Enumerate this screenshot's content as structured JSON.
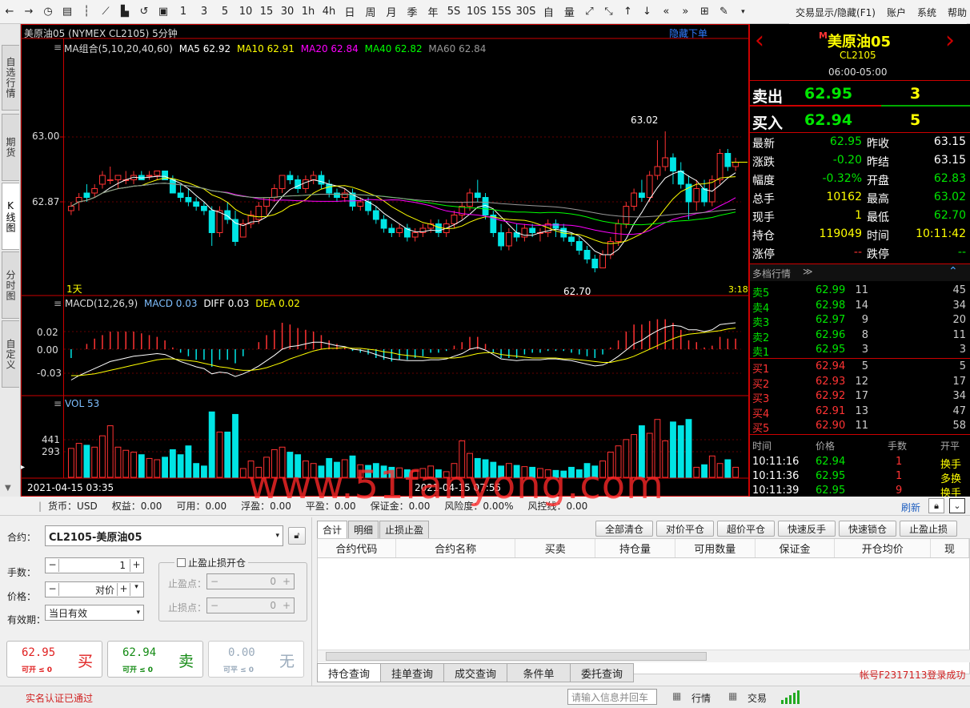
{
  "toolbar": {
    "items": [
      "1",
      "3",
      "5",
      "10",
      "15",
      "30",
      "1h",
      "4h",
      "日",
      "周",
      "月",
      "季",
      "年",
      "5S",
      "10S",
      "15S",
      "30S",
      "自",
      "量"
    ],
    "menu": [
      "交易显示/隐藏(F1)",
      "账户",
      "系统",
      "帮助"
    ]
  },
  "left_tabs": [
    "自选行情",
    "期货",
    "K线图",
    "分时图",
    "自定义"
  ],
  "chart": {
    "title": "美原油05 (NYMEX CL2105) 5分钟",
    "hide_order": "隐藏下单",
    "ma": {
      "label": "MA组合(5,10,20,40,60)",
      "ma5": "MA5 62.92",
      "ma10": "MA10 62.91",
      "ma20": "MA20 62.84",
      "ma40": "MA40 62.82",
      "ma60": "MA60 62.84"
    },
    "price_ticks": [
      "63.00",
      "62.87"
    ],
    "high_label": "63.02",
    "low_label": "62.70",
    "period_label": "1天",
    "countdown": "3:18",
    "macd": {
      "label": "MACD(12,26,9)",
      "macd": "MACD 0.03",
      "diff": "DIFF 0.03",
      "dea": "DEA 0.02",
      "ticks": [
        "0.02",
        "0.00",
        "-0.03"
      ]
    },
    "vol": {
      "label": "VOL 53",
      "ticks": [
        "441",
        "293"
      ]
    },
    "time_left": "2021-04-15 03:35",
    "time_mid": "2021-04-15 07:55"
  },
  "colors": {
    "up": "#ff3232",
    "down": "#00e5e5",
    "ma5": "#ffffff",
    "ma10": "#ffff00",
    "ma20": "#ff00ff",
    "ma40": "#00ff00",
    "ma60": "#999999"
  },
  "quote": {
    "name_prefix": "M",
    "name": "美原油05",
    "code": "CL2105",
    "session": "06:00-05:00",
    "sell_label": "卖出",
    "sell_price": "62.95",
    "sell_qty": "3",
    "buy_label": "买入",
    "buy_price": "62.94",
    "buy_qty": "5",
    "stats": [
      {
        "l1": "最新",
        "v1": "62.95",
        "c1": "g",
        "l2": "昨收",
        "v2": "63.15",
        "c2": "w"
      },
      {
        "l1": "涨跌",
        "v1": "-0.20",
        "c1": "g",
        "l2": "昨结",
        "v2": "63.15",
        "c2": "w"
      },
      {
        "l1": "幅度",
        "v1": "-0.32%",
        "c1": "g",
        "l2": "开盘",
        "v2": "62.83",
        "c2": "g"
      },
      {
        "l1": "总手",
        "v1": "10162",
        "c1": "y",
        "l2": "最高",
        "v2": "63.02",
        "c2": "g"
      },
      {
        "l1": "现手",
        "v1": "1",
        "c1": "y",
        "l2": "最低",
        "v2": "62.70",
        "c2": "g"
      },
      {
        "l1": "持仓",
        "v1": "119049",
        "c1": "y",
        "l2": "时间",
        "v2": "10:11:42",
        "c2": "y"
      },
      {
        "l1": "涨停",
        "v1": "--",
        "c1": "r",
        "l2": "跌停",
        "v2": "--",
        "c2": "g"
      }
    ],
    "depth_title": "多档行情",
    "asks": [
      {
        "l": "卖5",
        "p": "62.99",
        "q": "11",
        "t": "45"
      },
      {
        "l": "卖4",
        "p": "62.98",
        "q": "14",
        "t": "34"
      },
      {
        "l": "卖3",
        "p": "62.97",
        "q": "9",
        "t": "20"
      },
      {
        "l": "卖2",
        "p": "62.96",
        "q": "8",
        "t": "11"
      },
      {
        "l": "卖1",
        "p": "62.95",
        "q": "3",
        "t": "3"
      }
    ],
    "bids": [
      {
        "l": "买1",
        "p": "62.94",
        "q": "5",
        "t": "5"
      },
      {
        "l": "买2",
        "p": "62.93",
        "q": "12",
        "t": "17"
      },
      {
        "l": "买3",
        "p": "62.92",
        "q": "17",
        "t": "34"
      },
      {
        "l": "买4",
        "p": "62.91",
        "q": "13",
        "t": "47"
      },
      {
        "l": "买5",
        "p": "62.90",
        "q": "11",
        "t": "58"
      }
    ],
    "tick_headers": [
      "时间",
      "价格",
      "手数",
      "开平"
    ],
    "ticks": [
      {
        "t": "10:11:16",
        "p": "62.94",
        "q": "1",
        "k": "换手"
      },
      {
        "t": "10:11:36",
        "p": "62.95",
        "q": "1",
        "k": "多换"
      },
      {
        "t": "10:11:39",
        "p": "62.95",
        "q": "9",
        "k": "换手"
      }
    ]
  },
  "account_bar": {
    "items": [
      "货币：USD",
      "权益：0.00",
      "可用：0.00",
      "浮盈：0.00",
      "平盈：0.00",
      "保证金：0.00",
      "风险度：0.00%",
      "风控线：0.00"
    ],
    "refresh": "刷新"
  },
  "order": {
    "contract_label": "合约：",
    "contract_value": "CL2105-美原油05",
    "qty_label": "手数：",
    "qty_value": "1",
    "price_label": "价格：",
    "price_value": "对价",
    "valid_label": "有效期：",
    "valid_value": "当日有效",
    "stop_check": "止盈止损开仓",
    "tp_label": "止盈点：",
    "tp_value": "0",
    "sl_label": "止损点：",
    "sl_value": "0",
    "buy_price": "62.95",
    "buy_sub": "可开 ≤ 0",
    "buy_label": "买",
    "sell_price": "62.94",
    "sell_sub": "可开 ≤ 0",
    "sell_label": "卖",
    "none_price": "0.00",
    "none_sub": "可平 ≤ 0",
    "none_label": "无"
  },
  "positions": {
    "tabs": [
      "合计",
      "明细",
      "止损止盈"
    ],
    "actions": [
      "全部清仓",
      "对价平仓",
      "超价平仓",
      "快速反手",
      "快速锁仓",
      "止盈止损"
    ],
    "columns": [
      "合约代码",
      "合约名称",
      "买卖",
      "持仓量",
      "可用数量",
      "保证金",
      "开仓均价",
      "现"
    ],
    "bottom_tabs": [
      "持仓查询",
      "挂单查询",
      "成交查询",
      "条件单",
      "委托查询"
    ],
    "login_status": "帐号F2317113登录成功"
  },
  "status": {
    "verified": "实名认证已通过",
    "search_placeholder": "请输入信息并回车",
    "market": "行情",
    "trade": "交易"
  },
  "watermark": "www.51fanyong.com",
  "chart_data": {
    "type": "candlestick",
    "title": "美原油05 (NYMEX CL2105) 5分钟",
    "price_range": [
      62.66,
      63.06
    ],
    "candles": [
      [
        62.84,
        62.86,
        62.83,
        62.85
      ],
      [
        62.86,
        62.88,
        62.84,
        62.87
      ],
      [
        62.88,
        62.9,
        62.86,
        62.87
      ],
      [
        62.88,
        62.9,
        62.87,
        62.89
      ],
      [
        62.9,
        62.93,
        62.89,
        62.92
      ],
      [
        62.91,
        62.94,
        62.9,
        62.91
      ],
      [
        62.91,
        62.92,
        62.89,
        62.92
      ],
      [
        62.91,
        62.93,
        62.9,
        62.91
      ],
      [
        62.91,
        62.93,
        62.9,
        62.92
      ],
      [
        62.92,
        62.93,
        62.91,
        62.91
      ],
      [
        62.92,
        62.93,
        62.91,
        62.92
      ],
      [
        62.92,
        62.93,
        62.91,
        62.93
      ],
      [
        62.93,
        62.93,
        62.91,
        62.91
      ],
      [
        62.91,
        62.92,
        62.88,
        62.88
      ],
      [
        62.88,
        62.9,
        62.86,
        62.87
      ],
      [
        62.87,
        62.89,
        62.85,
        62.86
      ],
      [
        62.86,
        62.87,
        62.84,
        62.85
      ],
      [
        62.85,
        62.86,
        62.83,
        62.84
      ],
      [
        62.84,
        62.85,
        62.76,
        62.79
      ],
      [
        62.79,
        62.85,
        62.78,
        62.84
      ],
      [
        62.84,
        62.86,
        62.81,
        62.82
      ],
      [
        62.82,
        62.84,
        62.76,
        62.77
      ],
      [
        62.78,
        62.82,
        62.78,
        62.81
      ],
      [
        62.81,
        62.84,
        62.8,
        62.83
      ],
      [
        62.82,
        62.86,
        62.81,
        62.85
      ],
      [
        62.85,
        62.87,
        62.83,
        62.87
      ],
      [
        62.87,
        62.9,
        62.86,
        62.89
      ],
      [
        62.89,
        62.92,
        62.88,
        62.92
      ],
      [
        62.92,
        62.93,
        62.9,
        62.91
      ],
      [
        62.91,
        62.92,
        62.88,
        62.89
      ],
      [
        62.89,
        62.92,
        62.88,
        62.91
      ],
      [
        62.91,
        62.93,
        62.9,
        62.92
      ],
      [
        62.92,
        62.93,
        62.89,
        62.9
      ],
      [
        62.9,
        62.91,
        62.87,
        62.88
      ],
      [
        62.88,
        62.89,
        62.86,
        62.87
      ],
      [
        62.87,
        62.89,
        62.86,
        62.88
      ],
      [
        62.88,
        62.89,
        62.84,
        62.85
      ],
      [
        62.85,
        62.87,
        62.84,
        62.86
      ],
      [
        62.86,
        62.87,
        62.83,
        62.84
      ],
      [
        62.84,
        62.85,
        62.81,
        62.82
      ],
      [
        62.82,
        62.83,
        62.79,
        62.8
      ],
      [
        62.8,
        62.81,
        62.78,
        62.79
      ],
      [
        62.79,
        62.81,
        62.78,
        62.8
      ],
      [
        62.8,
        62.81,
        62.77,
        62.78
      ],
      [
        62.78,
        62.8,
        62.77,
        62.79
      ],
      [
        62.79,
        62.81,
        62.78,
        62.8
      ],
      [
        62.8,
        62.82,
        62.79,
        62.81
      ],
      [
        62.81,
        62.82,
        62.78,
        62.79
      ],
      [
        62.79,
        62.82,
        62.78,
        62.81
      ],
      [
        62.81,
        62.84,
        62.8,
        62.83
      ],
      [
        62.83,
        62.86,
        62.82,
        62.85
      ],
      [
        62.85,
        62.89,
        62.84,
        62.88
      ],
      [
        62.88,
        62.91,
        62.86,
        62.87
      ],
      [
        62.87,
        62.88,
        62.82,
        62.83
      ],
      [
        62.83,
        62.84,
        62.78,
        62.79
      ],
      [
        62.79,
        62.81,
        62.75,
        62.76
      ],
      [
        62.76,
        62.8,
        62.75,
        62.79
      ],
      [
        62.79,
        62.81,
        62.77,
        62.78
      ],
      [
        62.78,
        62.81,
        62.77,
        62.8
      ],
      [
        62.8,
        62.81,
        62.78,
        62.79
      ],
      [
        62.79,
        62.8,
        62.77,
        62.79
      ],
      [
        62.79,
        62.82,
        62.78,
        62.81
      ],
      [
        62.81,
        62.82,
        62.78,
        62.8
      ],
      [
        62.8,
        62.81,
        62.77,
        62.78
      ],
      [
        62.78,
        62.79,
        62.76,
        62.77
      ],
      [
        62.77,
        62.78,
        62.74,
        62.75
      ],
      [
        62.75,
        62.76,
        62.72,
        62.73
      ],
      [
        62.73,
        62.74,
        62.7,
        62.71
      ],
      [
        62.71,
        62.75,
        62.71,
        62.74
      ],
      [
        62.74,
        62.78,
        62.73,
        62.77
      ],
      [
        62.77,
        62.82,
        62.76,
        62.81
      ],
      [
        62.81,
        62.86,
        62.8,
        62.85
      ],
      [
        62.85,
        62.89,
        62.84,
        62.88
      ],
      [
        62.88,
        62.91,
        62.86,
        62.87
      ],
      [
        62.87,
        62.93,
        62.86,
        62.92
      ],
      [
        62.92,
        63.0,
        62.91,
        62.94
      ],
      [
        62.94,
        63.02,
        62.93,
        62.96
      ],
      [
        62.96,
        62.97,
        62.9,
        62.93
      ],
      [
        62.93,
        62.95,
        62.89,
        62.9
      ],
      [
        62.9,
        62.92,
        62.82,
        62.86
      ],
      [
        62.86,
        62.91,
        62.84,
        62.89
      ],
      [
        62.89,
        62.91,
        62.85,
        62.86
      ],
      [
        62.86,
        62.92,
        62.85,
        62.91
      ],
      [
        62.91,
        62.98,
        62.9,
        62.97
      ],
      [
        62.97,
        62.98,
        62.93,
        62.94
      ],
      [
        62.94,
        62.96,
        62.93,
        62.95
      ]
    ],
    "macd_diff": [
      -0.035,
      -0.03,
      -0.026,
      -0.022,
      -0.018,
      -0.014,
      -0.012,
      -0.01,
      -0.008,
      -0.007,
      -0.006,
      -0.005,
      -0.006,
      -0.01,
      -0.014,
      -0.017,
      -0.02,
      -0.022,
      -0.028,
      -0.026,
      -0.027,
      -0.031,
      -0.028,
      -0.024,
      -0.019,
      -0.013,
      -0.007,
      0.0,
      0.003,
      0.004,
      0.006,
      0.008,
      0.008,
      0.006,
      0.004,
      0.003,
      0.0,
      -0.001,
      -0.003,
      -0.006,
      -0.009,
      -0.011,
      -0.012,
      -0.013,
      -0.013,
      -0.013,
      -0.012,
      -0.012,
      -0.011,
      -0.008,
      -0.005,
      0.0,
      0.002,
      -0.001,
      -0.006,
      -0.011,
      -0.012,
      -0.013,
      -0.012,
      -0.012,
      -0.012,
      -0.011,
      -0.011,
      -0.012,
      -0.013,
      -0.015,
      -0.017,
      -0.019,
      -0.018,
      -0.014,
      -0.008,
      -0.001,
      0.006,
      0.01,
      0.016,
      0.021,
      0.025,
      0.027,
      0.026,
      0.022,
      0.022,
      0.02,
      0.022,
      0.028,
      0.029,
      0.03
    ],
    "macd_dea": [
      -0.03,
      -0.03,
      -0.029,
      -0.028,
      -0.026,
      -0.024,
      -0.022,
      -0.02,
      -0.018,
      -0.016,
      -0.014,
      -0.012,
      -0.011,
      -0.011,
      -0.012,
      -0.013,
      -0.014,
      -0.016,
      -0.018,
      -0.02,
      -0.021,
      -0.023,
      -0.024,
      -0.024,
      -0.023,
      -0.021,
      -0.018,
      -0.015,
      -0.011,
      -0.008,
      -0.005,
      -0.002,
      0.0,
      0.001,
      0.001,
      0.002,
      0.001,
      0.001,
      0.0,
      -0.001,
      -0.003,
      -0.004,
      -0.006,
      -0.007,
      -0.008,
      -0.009,
      -0.01,
      -0.01,
      -0.01,
      -0.01,
      -0.009,
      -0.007,
      -0.005,
      -0.004,
      -0.004,
      -0.006,
      -0.007,
      -0.008,
      -0.009,
      -0.01,
      -0.01,
      -0.01,
      -0.01,
      -0.011,
      -0.011,
      -0.012,
      -0.013,
      -0.014,
      -0.015,
      -0.015,
      -0.013,
      -0.011,
      -0.008,
      -0.004,
      0.0,
      0.004,
      0.008,
      0.012,
      0.015,
      0.017,
      0.018,
      0.019,
      0.02,
      0.021,
      0.023,
      0.024
    ],
    "volume": [
      230,
      270,
      255,
      240,
      330,
      410,
      240,
      215,
      200,
      180,
      150,
      140,
      160,
      220,
      180,
      250,
      110,
      90,
      520,
      360,
      360,
      500,
      70,
      130,
      80,
      160,
      220,
      240,
      200,
      180,
      130,
      110,
      90,
      150,
      120,
      140,
      170,
      100,
      95,
      110,
      90,
      80,
      75,
      60,
      50,
      70,
      90,
      60,
      45,
      110,
      290,
      190,
      150,
      140,
      120,
      90,
      110,
      95,
      85,
      80,
      70,
      60,
      55,
      50,
      80,
      60,
      110,
      90,
      130,
      200,
      250,
      300,
      340,
      410,
      350,
      460,
      290,
      440,
      410,
      460,
      80,
      100,
      170,
      110,
      140,
      80
    ]
  }
}
